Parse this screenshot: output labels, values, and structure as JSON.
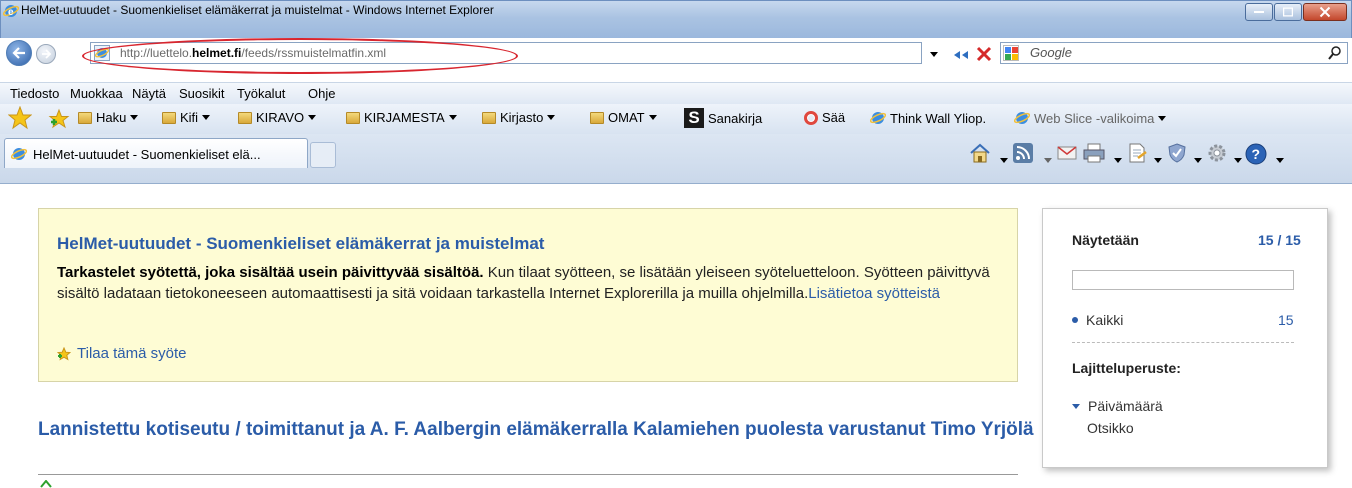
{
  "window": {
    "title": "HelMet-uutuudet - Suomenkieliset elämäkerrat ja muistelmat - Windows Internet Explorer"
  },
  "address": {
    "url_prefix": "http://luettelo.",
    "url_host": "helmet.fi",
    "url_path": "/feeds/rssmuistelmatfin.xml"
  },
  "search": {
    "placeholder": "Google"
  },
  "menu": {
    "items": [
      "Tiedosto",
      "Muokkaa",
      "Näytä",
      "Suosikit",
      "Työkalut",
      "Ohje"
    ]
  },
  "favorites": {
    "items": [
      {
        "label": "Haku"
      },
      {
        "label": "Kifi"
      },
      {
        "label": "KIRAVO"
      },
      {
        "label": "KIRJAMESTA"
      },
      {
        "label": "Kirjasto"
      },
      {
        "label": "OMAT"
      },
      {
        "label": "Sanakirja"
      },
      {
        "label": "Sää"
      },
      {
        "label": "Think Wall Yliop."
      },
      {
        "label": "Web Slice -valikoima"
      }
    ]
  },
  "tab": {
    "label": "HelMet-uutuudet - Suomenkieliset elä..."
  },
  "feed": {
    "title": "HelMet-uutuudet - Suomenkieliset elämäkerrat ja muistelmat",
    "desc_bold": "Tarkastelet syötettä, joka sisältää usein päivittyvää sisältöä.",
    "desc_text": " Kun tilaat syötteen, se lisätään yleiseen syöteluetteloon. Syötteen päivittyvä sisältö ladataan tietokoneeseen automaattisesti ja sitä voidaan tarkastella Internet Explorerilla ja muilla ohjelmilla.",
    "desc_link": "Lisätietoa syötteistä",
    "subscribe": "Tilaa tämä syöte"
  },
  "article": {
    "title": "Lannistettu kotiseutu / toimittanut ja A. F. Aalbergin elämäkerralla Kalamiehen puolesta varustanut Timo Yrjölä"
  },
  "sidebar": {
    "showing_label": "Näytetään",
    "showing_count": "15 / 15",
    "all_label": "Kaikki",
    "all_count": "15",
    "sort_label": "Lajitteluperuste:",
    "sort_date": "Päivämäärä",
    "sort_title": "Otsikko"
  }
}
